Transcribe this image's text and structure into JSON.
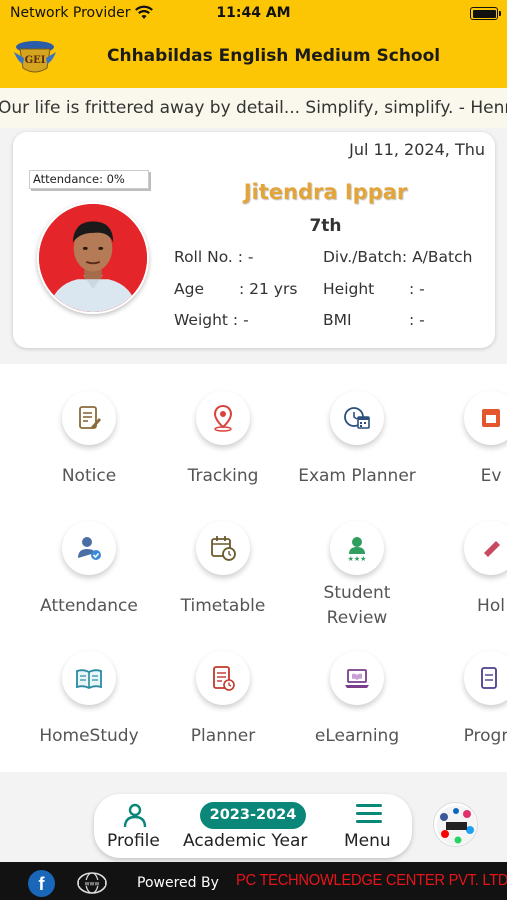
{
  "status_bar": {
    "carrier": "Network Provider",
    "time": "11:44 AM"
  },
  "header": {
    "school_name": "Chhabildas English Medium School",
    "logo_text": "GEI"
  },
  "ticker": {
    "text": "Our life is frittered away by detail... Simplify, simplify. - Henry David Thoreau"
  },
  "profile": {
    "date": "Jul 11, 2024, Thu",
    "attendance": "Attendance: 0%",
    "name": "Jitendra Ippar",
    "class": "7th",
    "roll_label": "Roll No. :",
    "roll_value": "-",
    "div_label": "Div./Batch:",
    "div_value": "A/Batch",
    "age_label": "Age",
    "age_value": ": 21 yrs",
    "height_label": "Height",
    "height_value": ": -",
    "weight_label": "Weight :",
    "weight_value": "-",
    "bmi_label": "BMI",
    "bmi_value": ": -"
  },
  "modules": [
    {
      "label": "Notice",
      "icon": "notice-icon"
    },
    {
      "label": "Tracking",
      "icon": "location-pin-icon"
    },
    {
      "label": "Exam Planner",
      "icon": "exam-calendar-icon"
    },
    {
      "label": "Ev",
      "icon": "event-icon"
    },
    {
      "label": "Attendance",
      "icon": "attendance-user-icon"
    },
    {
      "label": "Timetable",
      "icon": "timetable-icon"
    },
    {
      "label": "Student\nReview",
      "icon": "review-star-icon"
    },
    {
      "label": "Hol",
      "icon": "holiday-icon"
    },
    {
      "label": "HomeStudy",
      "icon": "book-icon"
    },
    {
      "label": "Planner",
      "icon": "planner-icon"
    },
    {
      "label": "eLearning",
      "icon": "laptop-book-icon"
    },
    {
      "label": "Progre",
      "icon": "progress-icon"
    }
  ],
  "bottom_nav": {
    "profile": "Profile",
    "year": "2023-2024",
    "academic_year": "Academic Year",
    "menu": "Menu"
  },
  "footer": {
    "powered_by": "Powered By",
    "company": "PC TECHNOWLEDGE CENTER PVT. LTD"
  }
}
